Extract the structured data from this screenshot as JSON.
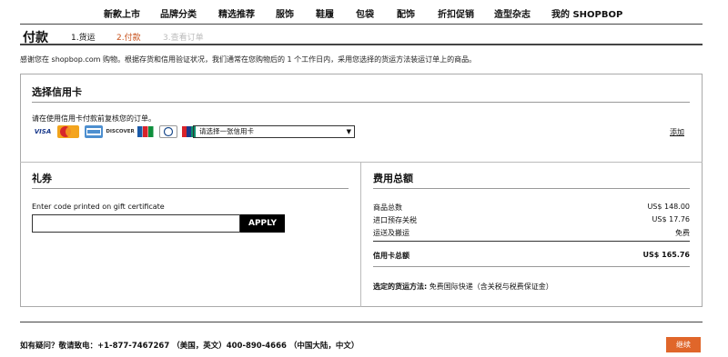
{
  "nav": [
    "新款上市",
    "品牌分类",
    "精选推荐",
    "服饰",
    "鞋履",
    "包袋",
    "配饰",
    "折扣促销",
    "造型杂志",
    "我的 SHOPBOP"
  ],
  "header": {
    "title": "付款",
    "steps": [
      "1.货运",
      "2.付款",
      "3.查看订单"
    ]
  },
  "notice": "感谢您在 shopbop.com 购物。根据存货和信用验证状况，我们通常在您购物后的 1 个工作日内，采用您选择的货运方法装运订单上的商品。",
  "credit_card": {
    "title": "选择信用卡",
    "instruction": "请在使用信用卡付款前复核您的订单。",
    "card_logos": [
      "VISA",
      "MasterCard",
      "AMEX",
      "DISCOVER",
      "JCB",
      "Diners Club",
      "UnionPay"
    ],
    "select_value": "请选择一张信用卡",
    "add_label": "添加"
  },
  "gift": {
    "title": "礼券",
    "instruction": "Enter code printed on gift certificate",
    "apply_label": "APPLY"
  },
  "summary": {
    "title": "费用总额",
    "rows": [
      {
        "label": "商品总数",
        "value": "US$ 148.00"
      },
      {
        "label": "进口预存关税",
        "value": "US$ 17.76"
      },
      {
        "label": "运送及搬运",
        "value": "免费"
      }
    ],
    "total_label": "信用卡总额",
    "total_value": "US$ 165.76",
    "shipping_label": "选定的货运方法:",
    "shipping_value": "免费国际快递（含关税与税费保证金）"
  },
  "footer": {
    "help": "如有疑问？敬请致电：+1-877-7467267 （美国，英文）400-890-4666 （中国大陆，中文）",
    "continue_label": "继续"
  },
  "colors": {
    "accent": "#e0662a",
    "active_step": "#c8521c",
    "inactive_step": "#bbbbbb"
  }
}
